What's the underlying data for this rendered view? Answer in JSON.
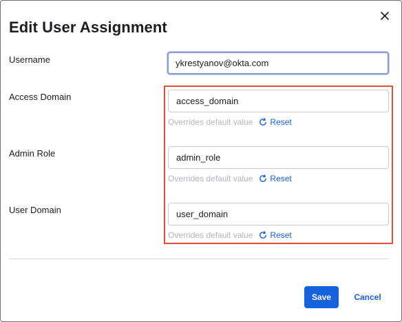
{
  "dialog": {
    "title": "Edit User Assignment",
    "close_icon": "close-icon"
  },
  "fields": {
    "username": {
      "label": "Username",
      "value": "ykrestyanov@okta.com"
    },
    "access_domain": {
      "label": "Access Domain",
      "value": "access_domain",
      "helper": "Overrides default value",
      "reset_label": "Reset"
    },
    "admin_role": {
      "label": "Admin Role",
      "value": "admin_role",
      "helper": "Overrides default value",
      "reset_label": "Reset"
    },
    "user_domain": {
      "label": "User Domain",
      "value": "user_domain",
      "helper": "Overrides default value",
      "reset_label": "Reset"
    }
  },
  "footer": {
    "save_label": "Save",
    "cancel_label": "Cancel"
  },
  "colors": {
    "primary": "#1662dd",
    "highlight_border": "#e0522f",
    "helper_text": "#b4b4bb",
    "focus_ring": "#8a9ad8"
  },
  "icons": {
    "reset": "refresh-icon",
    "close": "close-icon"
  }
}
